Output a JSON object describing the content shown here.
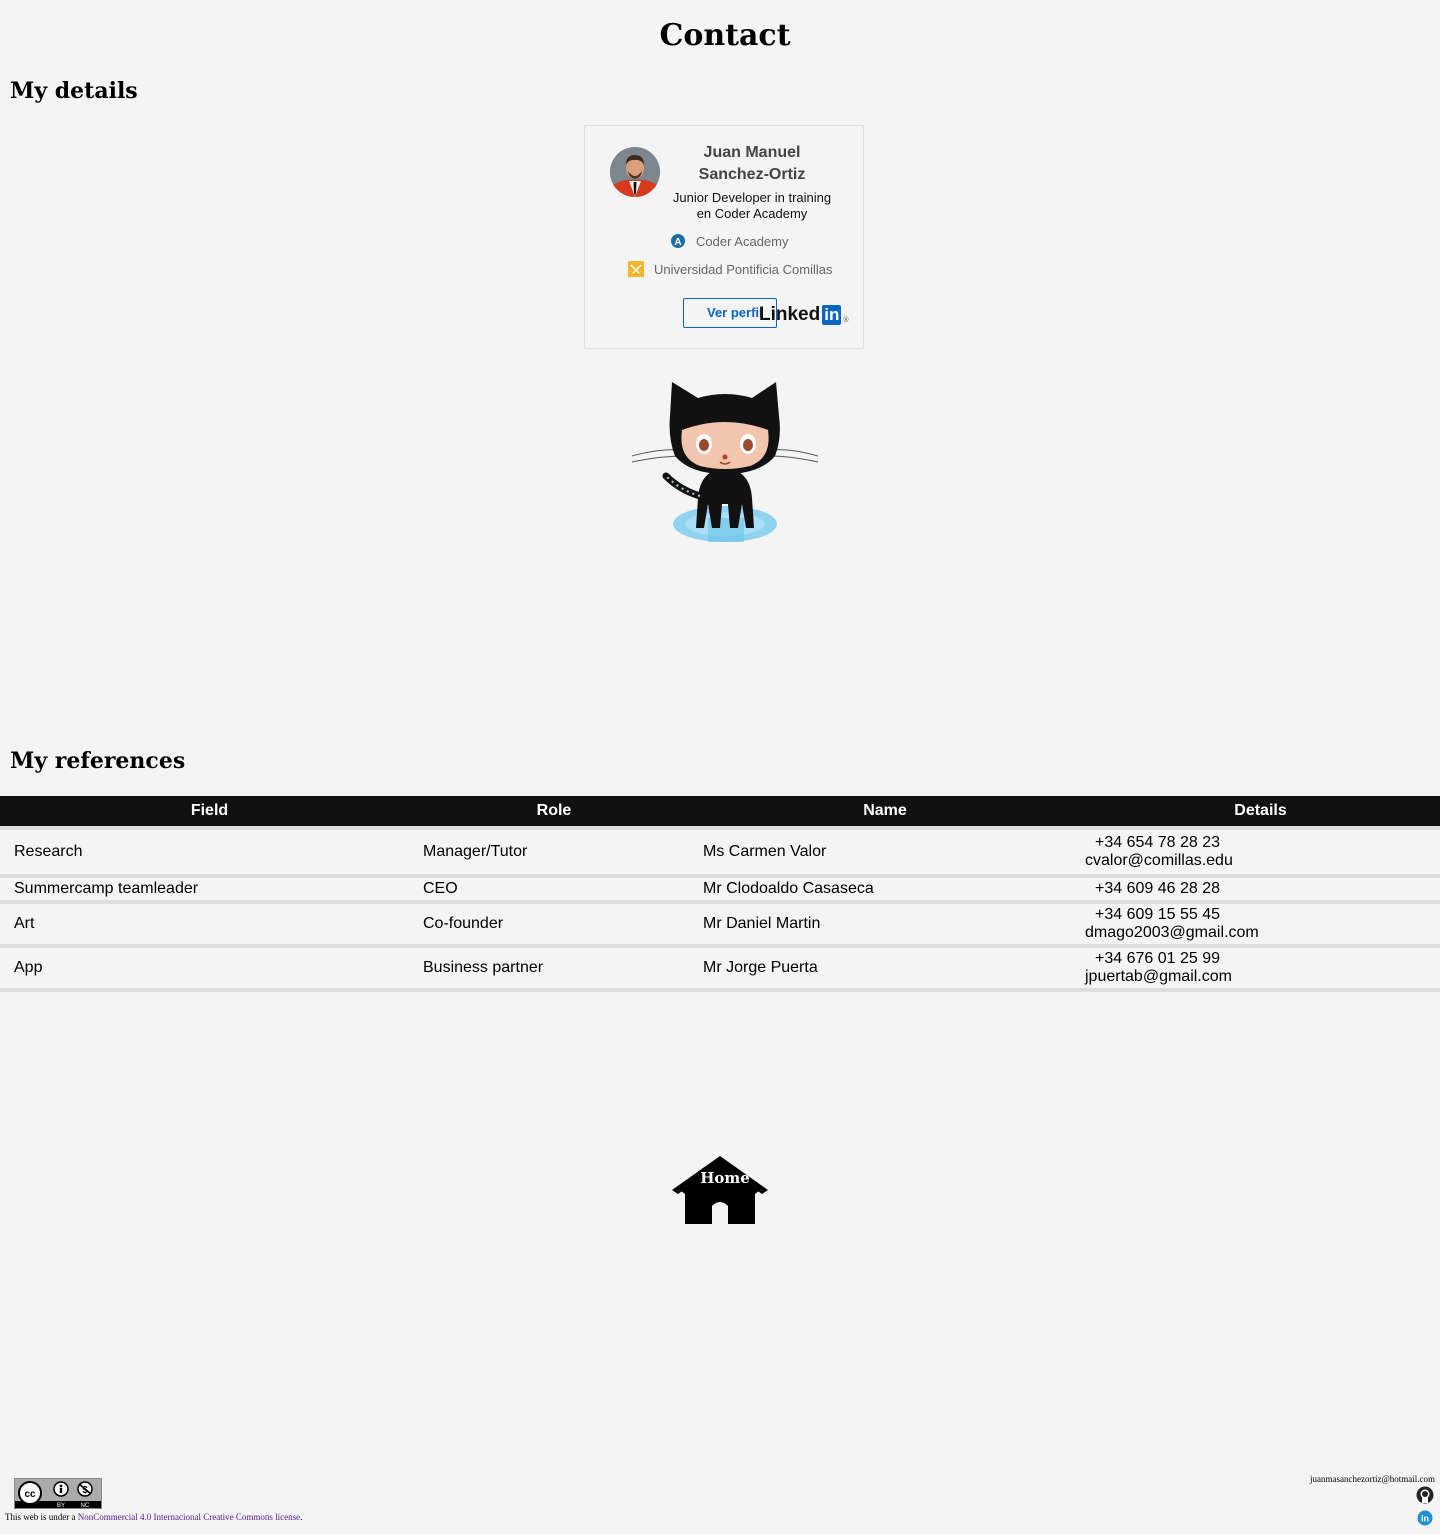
{
  "page": {
    "title": "Contact",
    "details_heading": "My details",
    "references_heading": "My references"
  },
  "linkedin_badge": {
    "name": "Juan Manuel Sanchez-Ortiz",
    "headline": "Junior Developer in training en Coder Academy",
    "organizations": [
      "Coder Academy",
      "Universidad Pontificia Comillas"
    ],
    "button_label": "Ver perfil",
    "brand": "Linked",
    "brand_box": "in",
    "brand_color": "#0a66c2"
  },
  "references": {
    "columns": [
      "Field",
      "Role",
      "Name",
      "Details"
    ],
    "rows": [
      {
        "field": "Research",
        "role": "Manager/Tutor",
        "name": "Ms Carmen Valor",
        "phone": "+34 654 78 28 23",
        "email": "cvalor@comillas.edu"
      },
      {
        "field": "Summercamp teamleader",
        "role": "CEO",
        "name": "Mr Clodoaldo Casaseca",
        "phone": "+34 609 46 28 28",
        "email": ""
      },
      {
        "field": "Art",
        "role": "Co-founder",
        "name": "Mr Daniel Martin",
        "phone": "+34 609 15 55 45",
        "email": "dmago2003@gmail.com"
      },
      {
        "field": "App",
        "role": "Business partner",
        "name": "Mr Jorge Puerta",
        "phone": "+34 676 01 25 99",
        "email": "jpuertab@gmail.com"
      }
    ]
  },
  "home": {
    "label": "Home"
  },
  "footer": {
    "license_prefix": "This web is under a ",
    "license_link": "NonCommercial 4.0 Internacional Creative Commons license",
    "license_suffix": ".",
    "email": "juanmasanchezortiz@hotmail.com",
    "cc_badge_labels": [
      "BY",
      "NC"
    ]
  }
}
